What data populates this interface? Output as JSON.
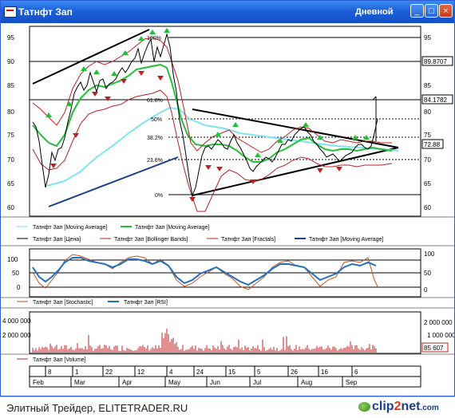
{
  "window": {
    "title": "Татнфт Зап",
    "timeframe": "Дневной",
    "buttons": {
      "minimize": "_",
      "maximize": "□",
      "close": "×"
    }
  },
  "price_panel": {
    "y_ticks": [
      "95",
      "90",
      "85",
      "80",
      "75",
      "70",
      "65",
      "60"
    ],
    "fib_labels": [
      "100%",
      "61.8%",
      "50%",
      "38.2%",
      "23.6%",
      "0%"
    ],
    "price_boxes": [
      "89.8707",
      "84.1782",
      "72.88"
    ],
    "legend": [
      {
        "text": "Татнфт Зап [Moving Average]",
        "color": "#7fe3f0"
      },
      {
        "text": "Татнфт Зап [Moving Average]",
        "color": "#22c03a"
      },
      {
        "text": "Татнфт Зап [Цена]",
        "color": "#000000"
      },
      {
        "text": "Татнфт Зап [Bollinger Bands]",
        "color": "#c02020"
      },
      {
        "text": "Татнфт Зап [Fractals]",
        "color": "#c02020"
      },
      {
        "text": "Татнфт Зап [Moving Average]",
        "color": "#1c3e8c"
      }
    ]
  },
  "osc_panel": {
    "y_ticks": [
      "100",
      "50",
      "0"
    ],
    "legend": [
      {
        "text": "Татнфт Зап [Stochastic]",
        "color": "#c85020"
      },
      {
        "text": "Татнфт Зап [RSI]",
        "color": "#2070c0"
      }
    ]
  },
  "volume_panel": {
    "left_ticks": [
      "4 000 000",
      "2 000 000"
    ],
    "right_ticks": [
      "2 000 000",
      "1 000 000"
    ],
    "value_box": "85 607",
    "legend": [
      {
        "text": "Татнфт Зап [Volume]",
        "color": "#c02020"
      }
    ]
  },
  "time_axis": {
    "days": [
      "8",
      "1",
      "22",
      "12",
      "4",
      "24",
      "15",
      "5",
      "26",
      "16",
      "6"
    ],
    "months": [
      "Feb",
      "Mar",
      "Apr",
      "May",
      "Jun",
      "Jul",
      "Aug",
      "Sep"
    ]
  },
  "footer": {
    "source": "Элитный Трейдер, ELITETRADER.RU",
    "logo_a": "clip",
    "logo_b": "2",
    "logo_c": "net",
    "logo_d": ".com"
  }
}
